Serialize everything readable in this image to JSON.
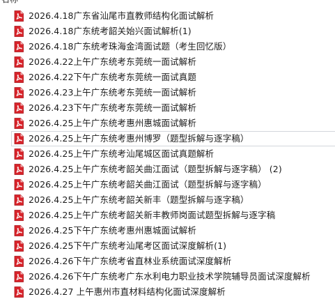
{
  "header": {
    "partial_label": "名称"
  },
  "files": [
    {
      "name": "2026.4.18广东省汕尾市直教师结构化面试解析",
      "icon": "pdf-icon"
    },
    {
      "name": "2026.4.18广东统考韶关始兴面试解析(1)",
      "icon": "pdf-icon"
    },
    {
      "name": "2026.4.18广东统考珠海金湾面试题（考生回忆版）",
      "icon": "pdf-icon"
    },
    {
      "name": "2026.4.22上午广东统考东莞统一面试解析",
      "icon": "pdf-icon"
    },
    {
      "name": "2026.4.22下午广东统考东莞统一面试真题",
      "icon": "pdf-icon"
    },
    {
      "name": "2026.4.23上午广东统考东莞统一面试解析",
      "icon": "pdf-icon"
    },
    {
      "name": "2026.4.23下午广东统考东莞统一面试解析",
      "icon": "pdf-icon"
    },
    {
      "name": "2026.4.25上午广东统考惠州惠城面试解析",
      "icon": "pdf-icon"
    },
    {
      "name": "2026.4.25上午广东统考惠州博罗（题型拆解与逐字稿）",
      "icon": "pdf-icon",
      "hover": true
    },
    {
      "name": "2026.4.25上午广东统考汕尾城区面试真题解析",
      "icon": "pdf-icon"
    },
    {
      "name": "2026.4.25上午广东统考韶关曲江面试（题型拆解与逐字稿） (2)",
      "icon": "pdf-icon"
    },
    {
      "name": "2026.4.25上午广东统考韶关曲江面试（题型拆解与逐字稿）",
      "icon": "pdf-icon"
    },
    {
      "name": "2026.4.25上午广东统考韶关新丰（题型拆解与逐字稿）",
      "icon": "pdf-icon"
    },
    {
      "name": "2026.4.25上午广东统考韶关新丰教师岗面试题型拆解与逐字稿",
      "icon": "pdf-icon"
    },
    {
      "name": "2026.4.25下午广东统考惠州惠城面试解析",
      "icon": "pdf-icon"
    },
    {
      "name": "2026.4.25下午广东统考汕尾考区面试深度解析(1)",
      "icon": "pdf-icon"
    },
    {
      "name": "2026.4.26下午广东统考省直林业系统面试深度解析",
      "icon": "pdf-icon"
    },
    {
      "name": "2026.4.26下午广东统考广东水利电力职业技术学院辅导员面试深度解析",
      "icon": "pdf-icon"
    },
    {
      "name": "2026.4.27 上午惠州市直材料结构化面试深度解析",
      "icon": "pdf-icon"
    }
  ],
  "colors": {
    "pdf_red": "#d8242b",
    "pdf_red_dark": "#a8141a",
    "hover_border": "#d2d6dc",
    "text": "#1c1c1c"
  }
}
